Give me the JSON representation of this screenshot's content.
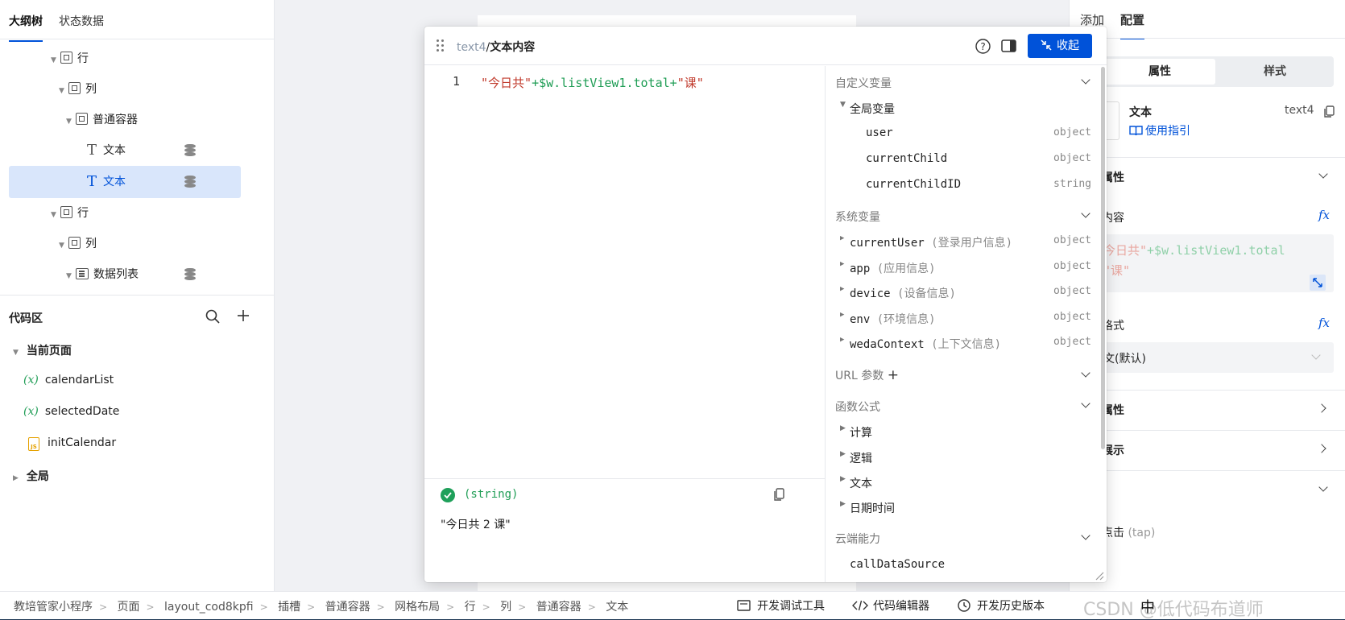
{
  "left": {
    "tabs": [
      "大纲树",
      "状态数据"
    ],
    "tree": [
      {
        "label": "行",
        "icon": "box"
      },
      {
        "label": "列",
        "icon": "box"
      },
      {
        "label": "普通容器",
        "icon": "box"
      },
      {
        "label": "文本",
        "icon": "text"
      },
      {
        "label": "文本",
        "icon": "text"
      },
      {
        "label": "行",
        "icon": "box"
      },
      {
        "label": "列",
        "icon": "box"
      },
      {
        "label": "数据列表",
        "icon": "list"
      }
    ],
    "code_area": {
      "title": "代码区",
      "current_page": "当前页面",
      "items": [
        "calendarList",
        "selectedDate",
        "initCalendar"
      ],
      "var_icon": "(x)",
      "global": "全局"
    }
  },
  "right": {
    "tabs": [
      "添加",
      "配置"
    ],
    "segment": [
      "属性",
      "样式"
    ],
    "component": {
      "name": "文本",
      "id": "text4",
      "guide": "使用指引"
    },
    "sections": {
      "props": "属性",
      "content_label": "内容",
      "content_line1a": "今日共\"",
      "content_line1b": "+$w.listView1.total",
      "content_line2": "\"课\"",
      "format_label": "格式",
      "format_value": "文(默认)",
      "props2": "属性",
      "display": "展示",
      "event": "点击",
      "event_tag": "(tap)"
    }
  },
  "dialog": {
    "title_prefix": "text4",
    "title_sep": "/",
    "title": "文本内容",
    "collapse": "收起",
    "code": {
      "line_no": "1",
      "s1": "\"今日共\"",
      "op1": "+$w.listView1.total+",
      "s2": "\"课\""
    },
    "result_type": "(string)",
    "result_value": "\"今日共 2 课\"",
    "groups": {
      "custom": "自定义变量",
      "global": "全局变量",
      "system": "系统变量",
      "url": "URL 参数",
      "func": "函数公式",
      "cloud": "云端能力"
    },
    "global_vars": [
      {
        "name": "user",
        "type": "object"
      },
      {
        "name": "currentChild",
        "type": "object"
      },
      {
        "name": "currentChildID",
        "type": "string"
      }
    ],
    "system_vars": [
      {
        "name": "currentUser",
        "desc": "(登录用户信息)",
        "type": "object"
      },
      {
        "name": "app",
        "desc": "(应用信息)",
        "type": "object"
      },
      {
        "name": "device",
        "desc": "(设备信息)",
        "type": "object"
      },
      {
        "name": "env",
        "desc": "(环境信息)",
        "type": "object"
      },
      {
        "name": "wedaContext",
        "desc": "(上下文信息)",
        "type": "object"
      }
    ],
    "functions": [
      "计算",
      "逻辑",
      "文本",
      "日期时间"
    ],
    "cloud_first": "callDataSource"
  },
  "bottom": {
    "crumbs": [
      "教培管家小程序",
      "页面",
      "layout_cod8kpfi",
      "插槽",
      "普通容器",
      "网格布局",
      "行",
      "列",
      "普通容器",
      "文本"
    ],
    "tools": [
      "开发调试工具",
      "代码编辑器",
      "开发历史版本"
    ],
    "watermark": "CSDN @低代码布道师",
    "ime": "中"
  },
  "colors": {
    "primary": "#0052d9",
    "string": "#c0392b",
    "expr": "#1f9d55",
    "selected": "#d9e6fb"
  }
}
